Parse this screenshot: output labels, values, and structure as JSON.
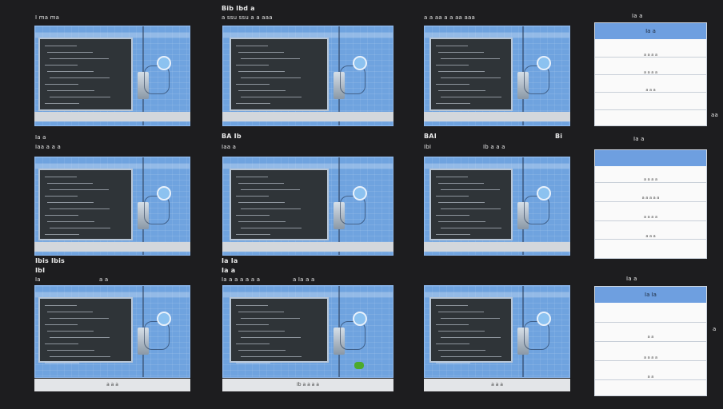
{
  "labels": {
    "r1c1": "I ma ma",
    "r1c2_top": "Bib Ibd a",
    "r1c2": "a ssu ssu a a aaa",
    "r1c3": "a a aa a a aa aaa",
    "r2c1_a": "Ia a",
    "r2c1_b": "Iaa a a a",
    "r2c2_a": "BA Ib",
    "r2c2_b": "Iaa a",
    "r2c3_a": "BAI",
    "r2c3_b": "IbI",
    "r2c3_c": "Ib a a a",
    "r2c3_d": "Bi",
    "r3c1_a": "Ibis Ibis",
    "r3c1_b": "IbI",
    "r3c1_c": "Ia",
    "r3c1_d": "a a",
    "r3c2_a": "Ia Ia",
    "r3c2_b": "Ia a",
    "r3c2_c": "Ia a a a a a a",
    "r3c2_top": "a Ia a a",
    "right_tiny_1": "aa",
    "right_tiny_2": "a"
  },
  "tiles": [
    {
      "id": "t11",
      "strip": ""
    },
    {
      "id": "t12",
      "strip": ""
    },
    {
      "id": "t13",
      "strip": ""
    },
    {
      "id": "t21",
      "strip": ""
    },
    {
      "id": "t22",
      "strip": ""
    },
    {
      "id": "t23",
      "strip": ""
    },
    {
      "id": "t31",
      "strip": "a a a"
    },
    {
      "id": "t32",
      "strip": "Ib a a a a"
    },
    {
      "id": "t33",
      "strip": "a a a"
    }
  ],
  "cards": [
    {
      "title_above": "Ia a",
      "header": "Ia a",
      "rows": [
        "a a a a",
        "a a a a",
        "a a a"
      ]
    },
    {
      "title_above": "Ia a",
      "header": "",
      "rows": [
        "a a a a",
        "a a a a a",
        "a a a a",
        "a a a"
      ]
    },
    {
      "title_above": "Ia a",
      "header": "Ia Ia",
      "rows": [
        "a a",
        "a a a a",
        "a a"
      ]
    }
  ],
  "colors": {
    "background": "#1d1d1f",
    "tile": "#6fa3df",
    "panel": "#2f3438",
    "card_header": "#6e9fe0"
  }
}
